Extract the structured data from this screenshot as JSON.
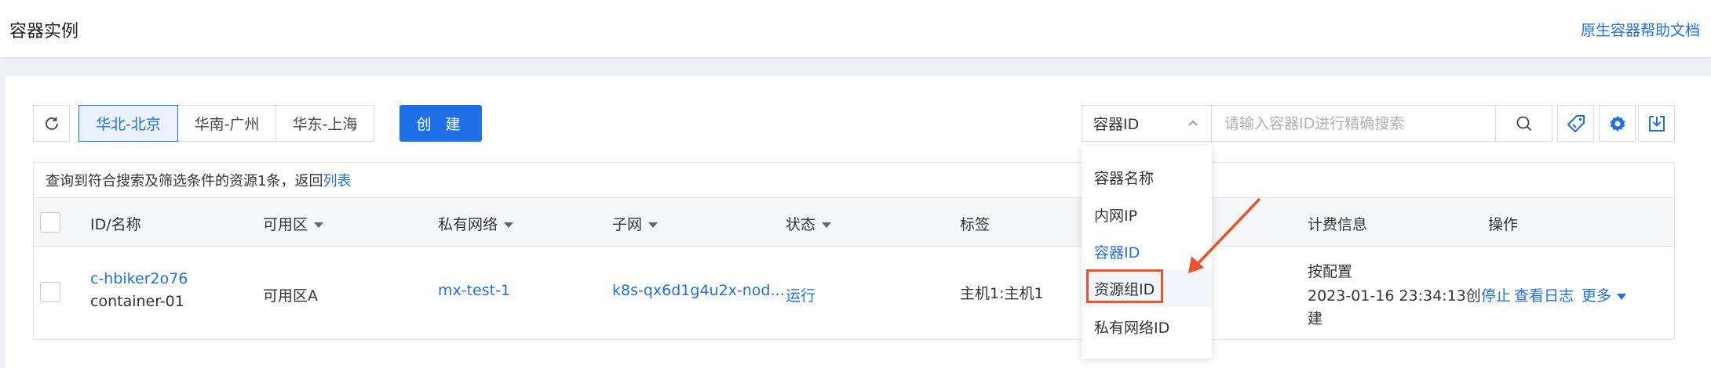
{
  "header": {
    "title": "容器实例",
    "help_link": "原生容器帮助文档"
  },
  "toolbar": {
    "regions": [
      "华北-北京",
      "华南-广州",
      "华东-上海"
    ],
    "active_region": "华北-北京",
    "create_label": "创 建"
  },
  "search": {
    "selected_field": "容器ID",
    "placeholder": "请输入容器ID进行精确搜索",
    "value": ""
  },
  "result": {
    "prefix": "查询到符合搜索及筛选条件的资源1条，返回",
    "link": "列表"
  },
  "table": {
    "columns": [
      "ID/名称",
      "可用区",
      "私有网络",
      "子网",
      "状态",
      "标签",
      "计费信息",
      "操作"
    ],
    "rows": [
      {
        "id": "c-hbiker2o76",
        "name": "container-01",
        "zone": "可用区A",
        "vpc": "mx-test-1",
        "subnet": "k8s-qx6d1g4u2x-nod...",
        "status": "运行",
        "tags": "主机1:主机1",
        "billing_type": "按配置",
        "billing_time_line1": "2023-01-16 23:34:13创",
        "billing_time_line2": "建",
        "action_stop": "停止",
        "action_logs": "查看日志",
        "action_more": "更多"
      }
    ]
  },
  "dropdown": {
    "options": [
      "容器名称",
      "内网IP",
      "容器ID",
      "资源组ID",
      "私有网络ID"
    ],
    "selected": "容器ID",
    "hovered": "资源组ID"
  },
  "colors": {
    "primary": "#1f6fe8",
    "annotation": "#e8542b"
  }
}
